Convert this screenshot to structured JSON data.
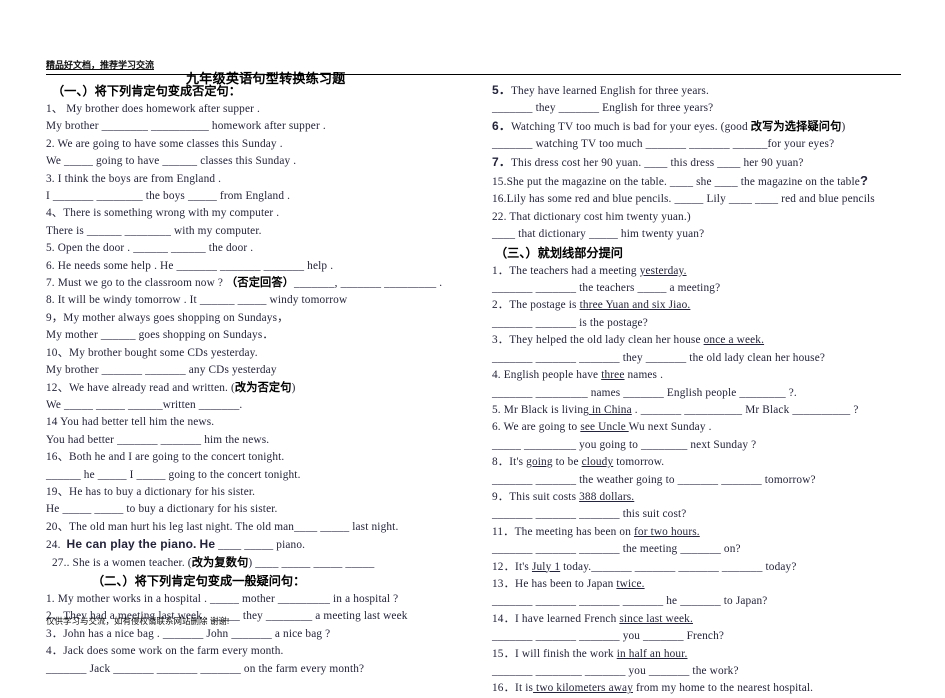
{
  "document": {
    "header_watermark": "精品好文档，推荐学习交流",
    "footer_watermark": "仅供学习与交流，如有侵权请联系网站删除 谢谢!",
    "title": "九年级英语句型转换练习题"
  },
  "sections": {
    "one": {
      "heading": "（一、）将下列肯定句变成否定句："
    },
    "two": {
      "heading": "（二、）将下列肯定句变成一般疑问句："
    },
    "three": {
      "heading": "（三、）就划线部分提问"
    }
  },
  "left_column": {
    "lines": [
      "1、  My brother does homework after supper .",
      "My brother ________ __________ homework after supper .",
      "2. We are going to have some classes this Sunday .",
      "We _____ going to have ______ classes this Sunday .",
      "3. I think the boys are from England .",
      "I _______ ________ the boys _____ from England .",
      "4、There is something wrong with my computer .",
      "There is ______ ________ with my computer.",
      "5. Open the door .     ______ ______ the door .",
      "6. He needs some help . He _______ _______ _______ help .",
      "8. It will be windy tomorrow . It ______ _____ windy tomorrow",
      "9，My mother always goes shopping on Sundays，",
      "My mother ______ goes shopping on Sundays．",
      "10、My brother bought some CDs yesterday.",
      "My brother _______ _______ any CDs yesterday",
      "14 You had better tell him the news.",
      "You had better _______ _______ him the news.",
      "16、Both he and I are going to the concert tonight.",
      "______ he _____ I _____ going to the concert tonight.",
      "19、He has to buy a dictionary for his sister.",
      "He _____ _____ to buy a dictionary for his sister.",
      "20、The old man hurt his leg last night.    The old man____ _____ last night.",
      "1. My mother works in a hospital .    _____ mother _________ in a hospital ?"
    ],
    "item7": {
      "prefix": "7. Must we go to the classroom now ?  ",
      "note": "（否定回答）",
      "suffix": "_______, _______ _________ ."
    },
    "item12": {
      "prefix": "12、We have already read and written. (",
      "note": "改为否定句",
      "suffix": ")"
    },
    "item12b": "We _____ _____  ______written _______.",
    "item24": {
      "prefix_num": "24.",
      "text_a": "He can play the piano.",
      "text_b": "He",
      "blanks": "____ _____ piano."
    },
    "item27": {
      "prefix": "27.. She is a women teacher. (",
      "note": "改为复数句",
      "suffix": ") ____ _____ _____ _____"
    },
    "item2b": "2．They had a meeting last week .     _____ they ________ a meeting last week",
    "item3b": "3．John has a nice bag .    _______ John _______ a nice bag ?",
    "item4b": "4．Jack does some work on the farm every month.",
    "item4c": "_______ Jack _______ _______ _______ on the farm every month?"
  },
  "right_column": {
    "item5": {
      "num": "5．",
      "text": "They have learned English for three years.",
      "answer": " _______ they _______ English for three years?"
    },
    "item6": {
      "num": "6．",
      "prefix": "Watching TV too much is bad for your eyes. (good ",
      "note": "改写为选择疑问句",
      "suffix": ")",
      "answer": "  _______ watching TV too much _______ _______ ______for your eyes?"
    },
    "item7": {
      "num": "7．",
      "text": "This dress cost her 90 yuan.    ____ this dress ____ her 90 yuan?"
    },
    "item15": "15.She put the magazine on the table. ____ she ____ the magazine on the table",
    "item16": "16.Lily has some red and blue pencils.    _____ Lily ____ ____ red and blue pencils",
    "item22": "22. That dictionary cost him twenty yuan.)",
    "item22b": "   ____ that dictionary _____ him twenty yuan?",
    "q1": {
      "pre": "1．The teachers had a meeting ",
      "ul": "yesterday.",
      "post": ""
    },
    "q1b": "_______ _______ the teachers _____ a meeting?",
    "q2": {
      "pre": "2．The postage is ",
      "ul": "three Yuan and six   Jiao.",
      "post": ""
    },
    "q2b": "_______ _______ is the postage?",
    "q3": {
      "pre": "3．They helped the old lady clean her house ",
      "ul": "once a week.",
      "post": ""
    },
    "q3b": " _______ _______ _______ they _______ the old lady clean her house?",
    "q4": {
      "pre": "4. English people have ",
      "ul": "three",
      "post": " names ."
    },
    "q4b": " _______ _________ names _______ English people ________ ?.",
    "q5": {
      "pre": "5. Mr Black is living",
      "ul": " in China",
      "post": " . _______ __________ Mr Black __________ ?"
    },
    "q6": {
      "pre": "6. We are going to ",
      "ul": "see Uncle ",
      "post": "Wu next Sunday ."
    },
    "q6b": "_____ _________ you going to ________ next Sunday ?",
    "q8": {
      "pre": "8．It's ",
      "ul": "going",
      "mid": " to be ",
      "ul2": "cloudy",
      "post": " tomorrow."
    },
    "q8b": "_______  _______ the weather going to _______ _______ tomorrow?",
    "q9": {
      "pre": "9．This suit costs ",
      "ul": "388 dollars.",
      "post": ""
    },
    "q9b": "_______ _______ _______ this suit cost?",
    "q11": {
      "pre": "11．The meeting has been on ",
      "ul": "for two hours.",
      "post": ""
    },
    "q11b": "_______ _______ _______ the meeting _______ on?",
    "q12": {
      "pre": "12．It's ",
      "ul": "July 1",
      "post": " today._______ _______ _______ _______ today?"
    },
    "q13": {
      "pre": "13．He has been to Japan ",
      "ul": "twice.",
      "post": ""
    },
    "q13b": "_______ _______ _______ _______ he _______ to Japan?",
    "q14": {
      "pre": "14．I have learned French ",
      "ul": "since last week.",
      "post": ""
    },
    "q14b": "_______ _______ _______ you _______ French?",
    "q15": {
      "pre": "15．I will finish the work ",
      "ul": "in half an hour.",
      "post": ""
    },
    "q15b": "_______ ________ _______ you _______ the work?",
    "q16": {
      "pre": "16．It is",
      "ul": " two kilometers away",
      "post": " from my home to the nearest hospital."
    }
  }
}
